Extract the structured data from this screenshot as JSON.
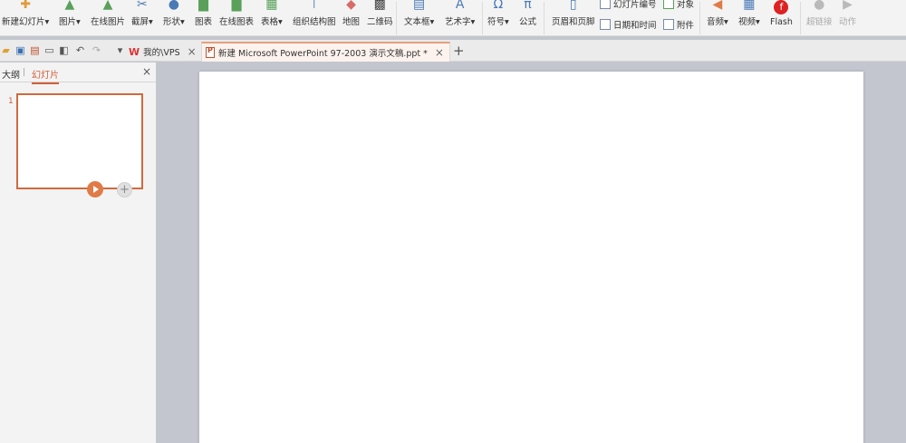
{
  "ribbon": {
    "buttons": {
      "new_slide": "新建幻灯片",
      "picture": "图片",
      "online_picture": "在线图片",
      "screenshot": "截屏",
      "shapes": "形状",
      "chart": "图表",
      "online_chart": "在线图表",
      "table": "表格",
      "org_chart": "组织结构图",
      "map": "地图",
      "qrcode": "二维码",
      "textbox": "文本框",
      "wordart": "艺术字",
      "symbol": "符号",
      "formula": "公式",
      "header_footer": "页眉和页脚",
      "audio": "音频",
      "video": "视频",
      "flash": "Flash",
      "hyperlink": "超链接",
      "action": "动作"
    },
    "small": {
      "slide_number": "幻灯片编号",
      "object": "对象",
      "date_time": "日期和时间",
      "attachment": "附件"
    },
    "dropdown_arrow": "▾"
  },
  "tabs": {
    "vps": "我的\\VPS",
    "document": "新建 Microsoft PowerPoint 97-2003 演示文稿.ppt *",
    "close_glyph": "×",
    "new_tab_glyph": "+"
  },
  "left_pane": {
    "tab_outline": "大纲",
    "divider": "|",
    "tab_slides": "幻灯片",
    "close_glyph": "×",
    "slide_number": "1",
    "add_glyph": "+"
  },
  "colors": {
    "accent": "#d0603a",
    "canvas_bg": "#c3c6ce",
    "ribbon_bg": "#f3f3f3"
  }
}
